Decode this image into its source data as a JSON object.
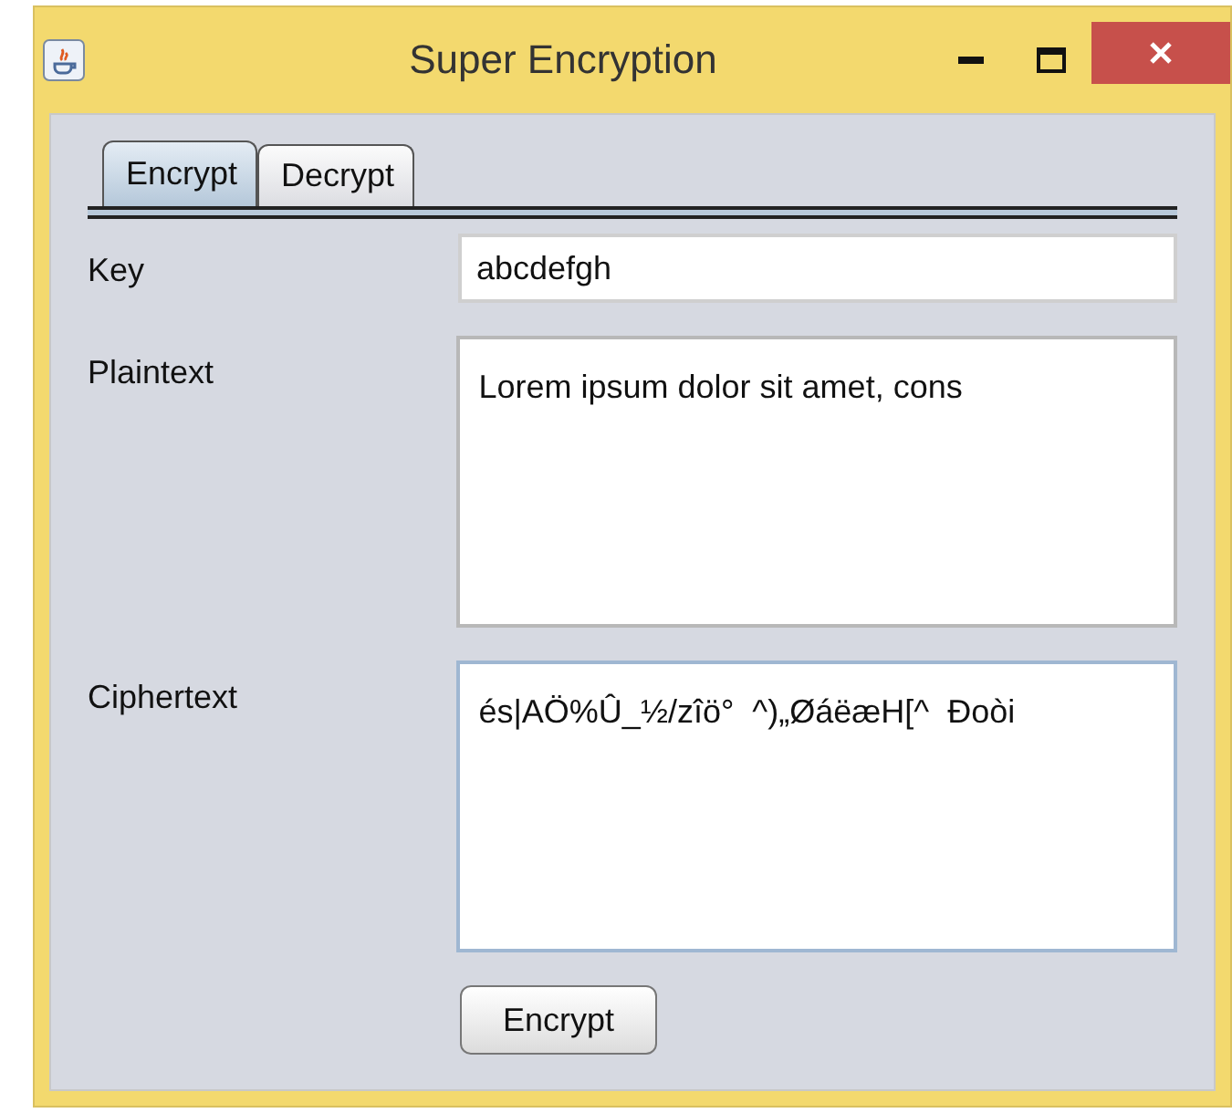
{
  "window": {
    "title": "Super Encryption"
  },
  "tabs": [
    {
      "label": "Encrypt",
      "selected": true
    },
    {
      "label": "Decrypt",
      "selected": false
    }
  ],
  "fields": [
    {
      "label": "Key",
      "kind": "line",
      "value": "abcdefgh",
      "focused": false
    },
    {
      "label": "Plaintext",
      "kind": "area",
      "value": "Lorem ipsum dolor sit amet, cons",
      "focused": false
    },
    {
      "label": "Ciphertext",
      "kind": "area",
      "value": "és|AÖ%Û_½/zîö°  ^)„ØáëæH[^  Ðoòi",
      "focused": true
    }
  ],
  "button": "Encrypt"
}
